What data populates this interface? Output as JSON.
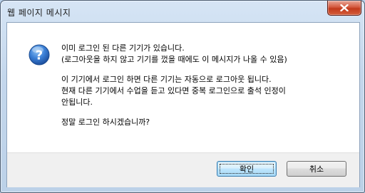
{
  "dialog": {
    "title": "웹 페이지 메시지",
    "icon": "question-icon",
    "message_lines": [
      "이미 로그인 된 다른 기기가 있습니다.",
      "(로그아웃을 하지 않고 기기를 껐을 때에도 이 메시지가 나올 수 있음)",
      "",
      "이 기기에서 로그인 하면 다른 기기는 자동으로 로그아웃 됩니다.",
      "현재 다른 기기에서 수업을 듣고 있다면 중복 로그인으로 출석 인정이",
      "안됩니다.",
      "",
      "정말 로그인 하시겠습니까?"
    ],
    "buttons": {
      "ok_label": "확인",
      "cancel_label": "취소"
    }
  },
  "colors": {
    "frame": "#c4d7ec",
    "close_button": "#c9462a",
    "icon_blue": "#2f6fc9"
  }
}
